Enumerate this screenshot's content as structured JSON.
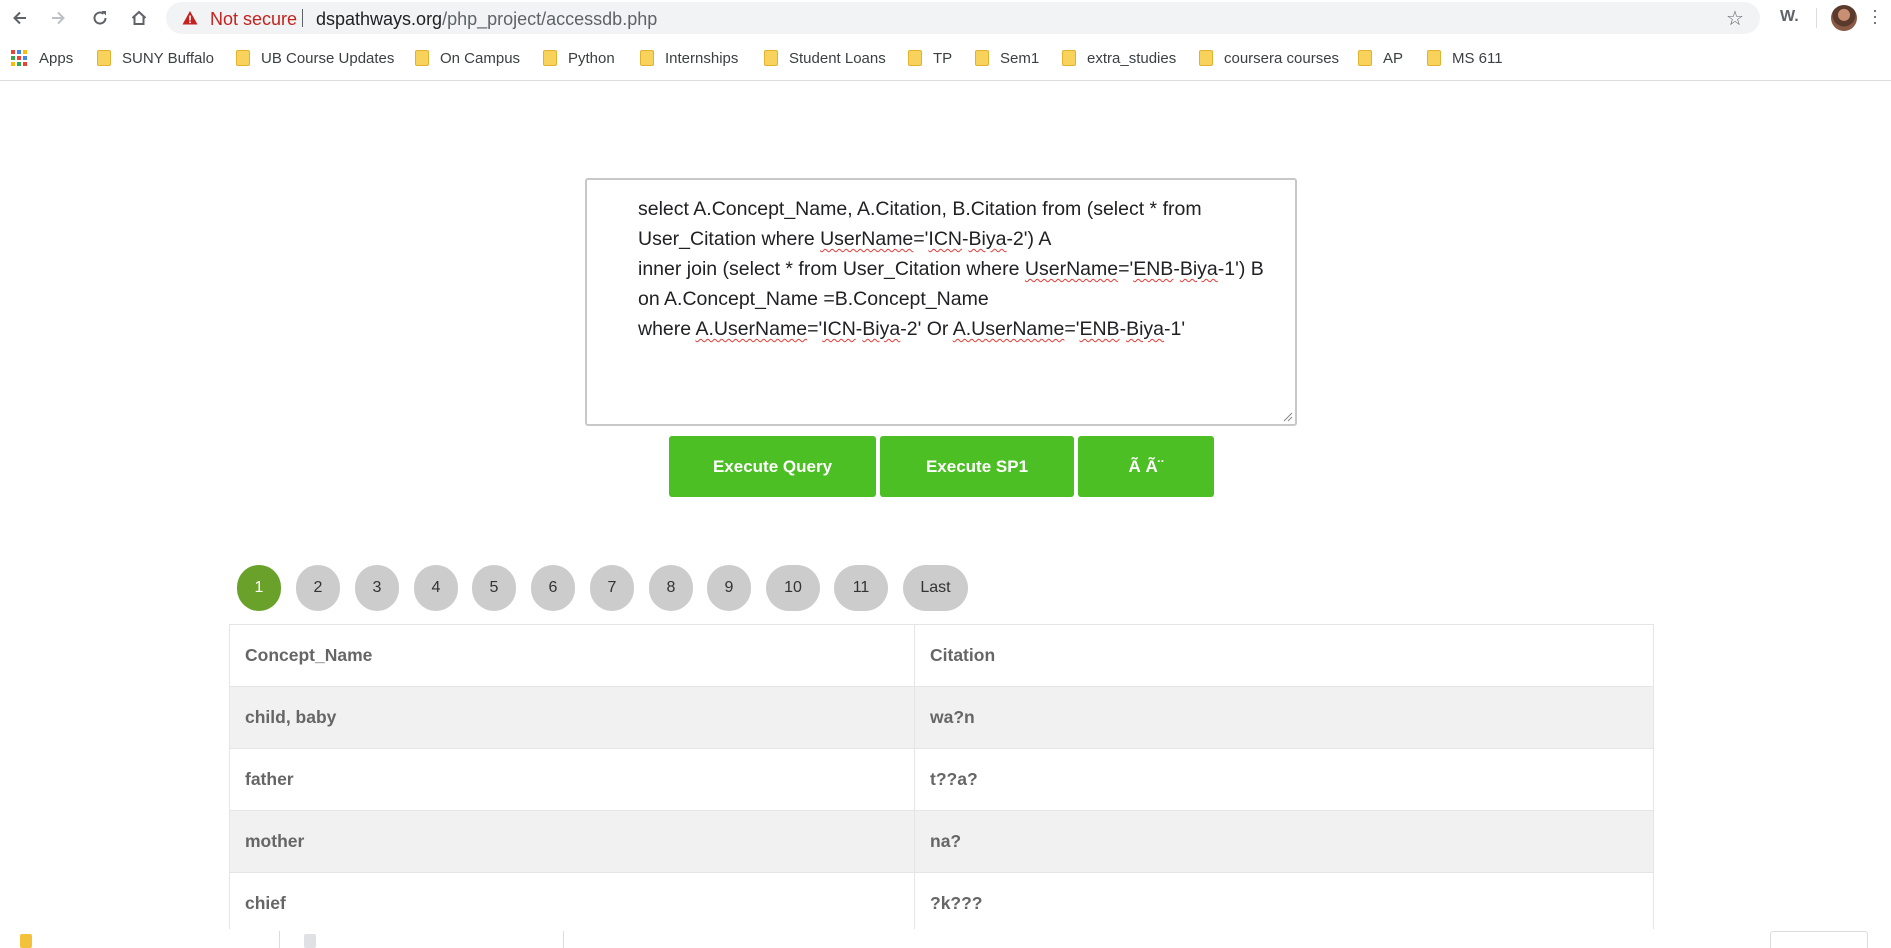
{
  "browser": {
    "security_label": "Not secure",
    "url_domain": "dspathways.org",
    "url_path": "/php_project/accessdb.php",
    "extension_label": "W."
  },
  "bookmarks": [
    {
      "label": "Apps",
      "icon": "apps-grid-icon"
    },
    {
      "label": "SUNY Buffalo",
      "icon": "folder-icon"
    },
    {
      "label": "UB Course Updates",
      "icon": "folder-icon"
    },
    {
      "label": "On Campus",
      "icon": "folder-icon"
    },
    {
      "label": "Python",
      "icon": "folder-icon"
    },
    {
      "label": "Internships",
      "icon": "folder-icon"
    },
    {
      "label": "Student Loans",
      "icon": "folder-icon"
    },
    {
      "label": "TP",
      "icon": "folder-icon"
    },
    {
      "label": "Sem1",
      "icon": "folder-icon"
    },
    {
      "label": "extra_studies",
      "icon": "folder-icon"
    },
    {
      "label": "coursera courses",
      "icon": "folder-icon"
    },
    {
      "label": "AP",
      "icon": "folder-icon"
    },
    {
      "label": "MS 611",
      "icon": "folder-icon"
    }
  ],
  "query": {
    "lines": [
      "select A.Concept_Name, A.Citation, B.Citation from (select * from",
      "User_Citation where UserName='ICN-Biya-2') A",
      "inner join (select * from User_Citation where UserName='ENB-Biya-1') B",
      "on A.Concept_Name =B.Concept_Name",
      "where A.UserName='ICN-Biya-2' Or A.UserName='ENB-Biya-1'"
    ]
  },
  "buttons": {
    "execute_query": "Execute Query",
    "execute_sp1": "Execute SP1",
    "third": "Ã Ã¨"
  },
  "pagination": {
    "pages": [
      "1",
      "2",
      "3",
      "4",
      "5",
      "6",
      "7",
      "8",
      "9",
      "10",
      "11",
      "Last"
    ],
    "active": "1"
  },
  "table": {
    "headers": [
      "Concept_Name",
      "Citation"
    ],
    "rows": [
      [
        "child, baby",
        "wa?n"
      ],
      [
        "father",
        "t??a?"
      ],
      [
        "mother",
        "na?"
      ],
      [
        "chief",
        "?k???"
      ]
    ]
  },
  "colors": {
    "button_green": "#4cbf25",
    "active_page_green": "#6aa12a",
    "not_secure_red": "#c5221f"
  }
}
